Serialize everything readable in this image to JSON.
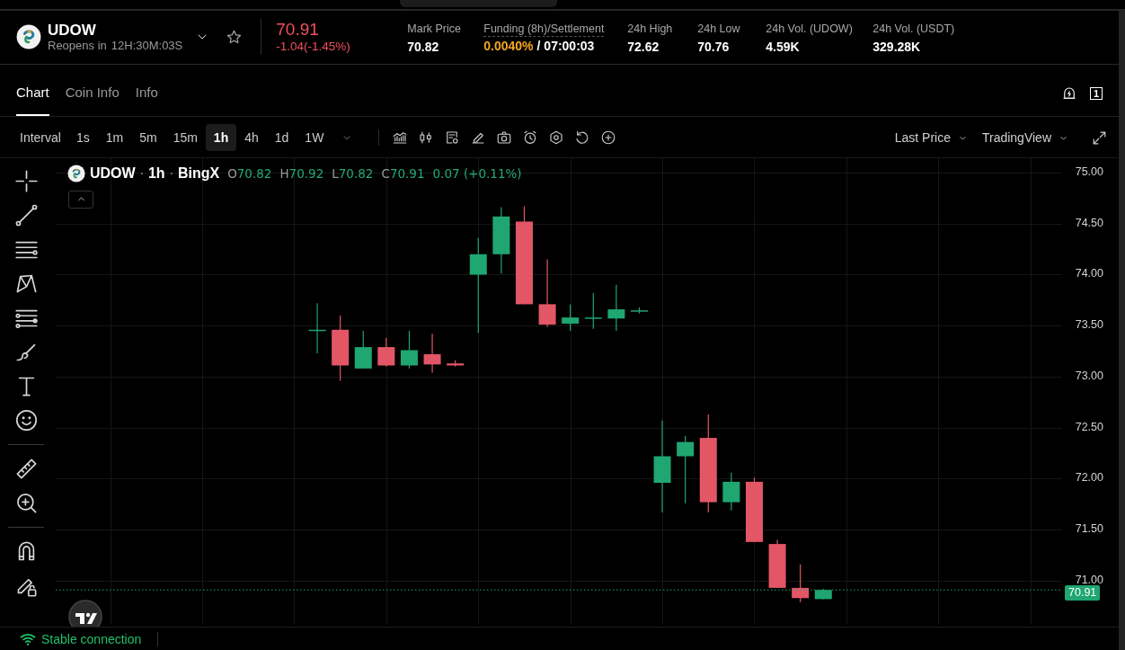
{
  "symbol": {
    "name": "UDOW",
    "reopens_label": "Reopens in",
    "countdown": "12H:30M:03S",
    "favorite": false
  },
  "price": {
    "last": "70.91",
    "change": "-1.04(-1.45%)"
  },
  "stats": [
    {
      "kind": "plain",
      "label": "Mark Price",
      "value": "70.82"
    },
    {
      "kind": "funding",
      "label": "Funding (8h)/Settlement",
      "rate": "0.0040%",
      "value": "/ 07:00:03"
    },
    {
      "kind": "plain",
      "label": "24h High",
      "value": "72.62"
    },
    {
      "kind": "plain",
      "label": "24h Low",
      "value": "70.76"
    },
    {
      "kind": "plain",
      "label": "24h Vol. (UDOW)",
      "value": "4.59K"
    },
    {
      "kind": "plain",
      "label": "24h Vol. (USDT)",
      "value": "329.28K"
    }
  ],
  "tabs": [
    {
      "label": "Chart",
      "selected": true
    },
    {
      "label": "Coin Info",
      "selected": false
    },
    {
      "label": "Info",
      "selected": false
    }
  ],
  "layout_count": "1",
  "toolbar": {
    "interval_label": "Interval",
    "intervals": [
      {
        "label": "1s",
        "selected": false
      },
      {
        "label": "1m",
        "selected": false
      },
      {
        "label": "5m",
        "selected": false
      },
      {
        "label": "15m",
        "selected": false
      },
      {
        "label": "1h",
        "selected": true
      },
      {
        "label": "4h",
        "selected": false
      },
      {
        "label": "1d",
        "selected": false
      },
      {
        "label": "1W",
        "selected": false
      }
    ],
    "price_source": "Last Price",
    "chart_style": "TradingView"
  },
  "chart": {
    "legend": {
      "symbol": "UDOW",
      "interval": "1h",
      "separator": "·",
      "exchange": "BingX",
      "open_label": "O",
      "open": "70.82",
      "high_label": "H",
      "high": "70.92",
      "low_label": "L",
      "low": "70.82",
      "close_label": "C",
      "close": "70.91",
      "change": "0.07 (+0.11%)"
    },
    "last_price": "70.91",
    "price_axis": [
      "75.00",
      "74.50",
      "74.00",
      "73.50",
      "73.00",
      "72.50",
      "72.00",
      "71.50",
      "71.00"
    ]
  },
  "status": {
    "text": "Stable connection",
    "connected": true
  }
}
